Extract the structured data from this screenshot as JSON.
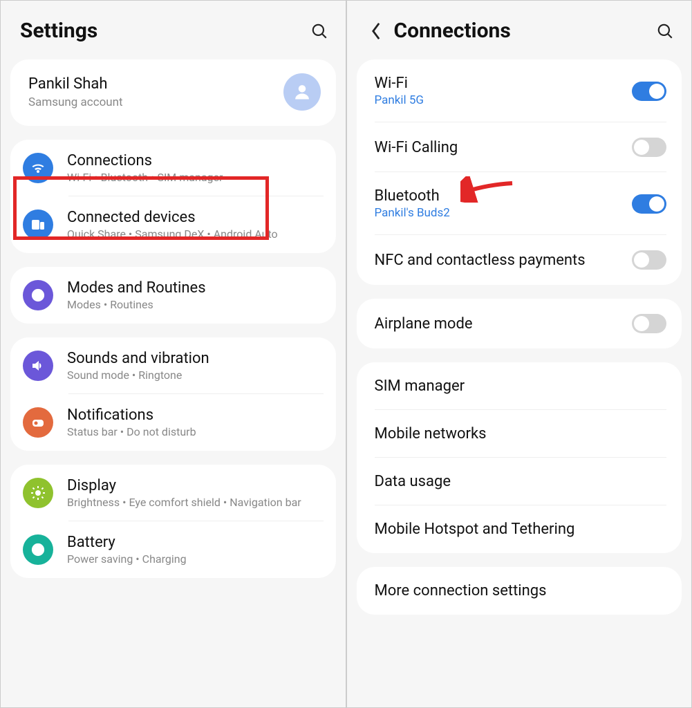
{
  "left": {
    "title": "Settings",
    "account": {
      "name": "Pankil Shah",
      "sub": "Samsung account"
    },
    "groups": [
      [
        {
          "icon": "wifi",
          "color": "#2f7de1",
          "title": "Connections",
          "sub": "Wi-Fi  •  Bluetooth  •  SIM manager",
          "highlighted": true
        },
        {
          "icon": "devices",
          "color": "#2f7de1",
          "title": "Connected devices",
          "sub": "Quick Share  •  Samsung DeX  •  Android Auto"
        }
      ],
      [
        {
          "icon": "routines",
          "color": "#6b57d9",
          "title": "Modes and Routines",
          "sub": "Modes  •  Routines"
        }
      ],
      [
        {
          "icon": "sound",
          "color": "#6b57d9",
          "title": "Sounds and vibration",
          "sub": "Sound mode  •  Ringtone"
        },
        {
          "icon": "notif",
          "color": "#e36a3e",
          "title": "Notifications",
          "sub": "Status bar  •  Do not disturb"
        }
      ],
      [
        {
          "icon": "display",
          "color": "#8fc22e",
          "title": "Display",
          "sub": "Brightness  •  Eye comfort shield  •  Navigation bar"
        },
        {
          "icon": "battery",
          "color": "#17b29a",
          "title": "Battery",
          "sub": "Power saving  •  Charging"
        }
      ]
    ]
  },
  "right": {
    "title": "Connections",
    "groups": [
      [
        {
          "title": "Wi-Fi",
          "sub": "Pankil 5G",
          "toggle": "on",
          "arrow": false
        },
        {
          "title": "Wi-Fi Calling",
          "toggle": "off",
          "arrow": false
        },
        {
          "title": "Bluetooth",
          "sub": "Pankil's Buds2",
          "toggle": "on",
          "arrow": true
        },
        {
          "title": "NFC and contactless payments",
          "toggle": "off",
          "arrow": false
        }
      ],
      [
        {
          "title": "Airplane mode",
          "toggle": "off"
        }
      ],
      [
        {
          "title": "SIM manager"
        },
        {
          "title": "Mobile networks"
        },
        {
          "title": "Data usage"
        },
        {
          "title": "Mobile Hotspot and Tethering"
        }
      ],
      [
        {
          "title": "More connection settings"
        }
      ]
    ]
  }
}
